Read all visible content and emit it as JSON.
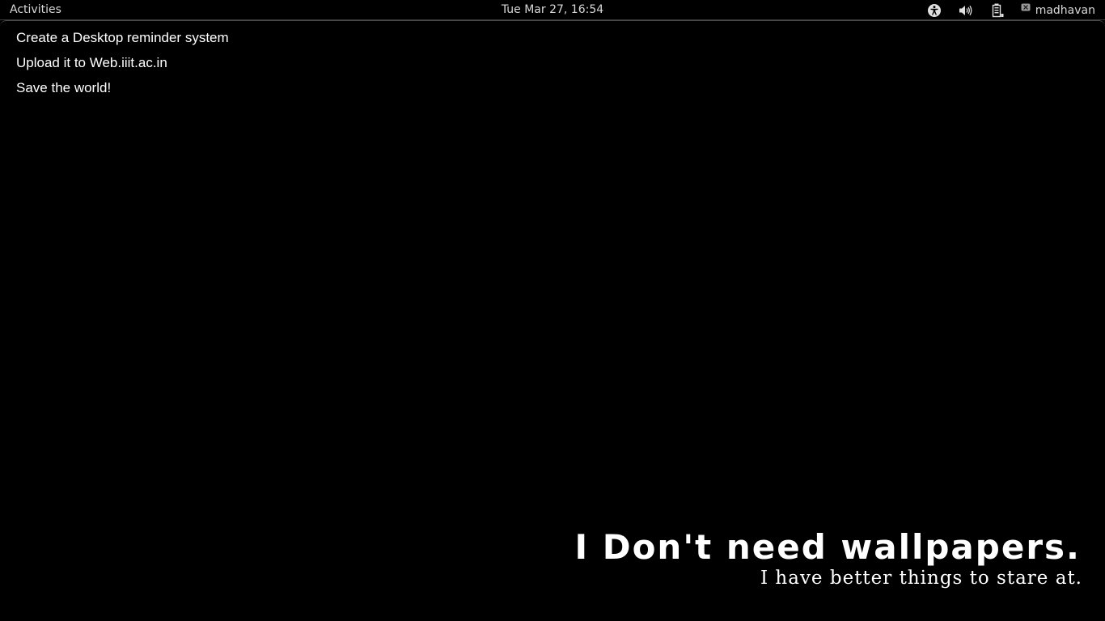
{
  "topbar": {
    "activities_label": "Activities",
    "clock": "Tue Mar 27, 16:54",
    "status_icons": [
      "accessibility-icon",
      "volume-icon",
      "battery-icon"
    ],
    "user_name": "madhavan",
    "presence_icon": "presence-offline-icon"
  },
  "desktop": {
    "reminders": [
      "Create a Desktop reminder system",
      "Upload it to Web.iiit.ac.in",
      "Save the world!"
    ],
    "wallpaper": {
      "headline": "I Don't need wallpapers.",
      "subline": "I have better things to stare at."
    }
  },
  "colors": {
    "background": "#000000",
    "text": "#ffffff",
    "panel_text": "#d8d8d8"
  }
}
